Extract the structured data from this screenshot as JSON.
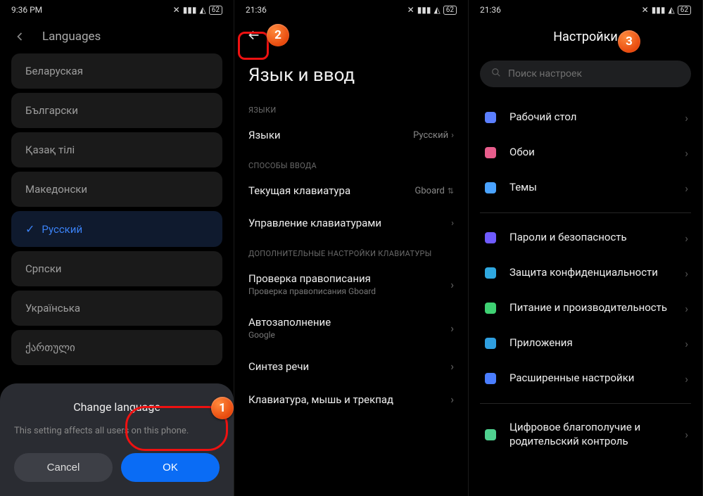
{
  "panel1": {
    "status_time": "9:36 PM",
    "status_battery": "62",
    "header_title": "Languages",
    "languages": [
      "Беларуская",
      "Български",
      "Қазақ тілі",
      "Македонски",
      "Русский",
      "Српски",
      "Українська",
      "ქართული"
    ],
    "selected_index": 4,
    "dialog": {
      "title": "Change language",
      "message": "This setting affects all users on this phone.",
      "cancel": "Cancel",
      "ok": "OK"
    }
  },
  "panel2": {
    "status_time": "21:36",
    "status_battery": "62",
    "title": "Язык и ввод",
    "section1": "ЯЗЫКИ",
    "row_languages": {
      "label": "Языки",
      "value": "Русский"
    },
    "section2": "СПОСОБЫ ВВОДА",
    "row_keyboard": {
      "label": "Текущая клавиатура",
      "value": "Gboard"
    },
    "row_manage": {
      "label": "Управление клавиатурами"
    },
    "section3": "ДОПОЛНИТЕЛЬНЫЕ НАСТРОЙКИ КЛАВИАТУРЫ",
    "row_spell": {
      "label": "Проверка правописания",
      "sub": "Проверка правописания Gboard"
    },
    "row_autofill": {
      "label": "Автозаполнение",
      "sub": "Google"
    },
    "row_tts": {
      "label": "Синтез речи"
    },
    "row_mouse": {
      "label": "Клавиатура, мышь и трекпад"
    }
  },
  "panel3": {
    "status_time": "21:36",
    "status_battery": "62",
    "header_title": "Настройки",
    "search_placeholder": "Поиск настроек",
    "items_top": [
      {
        "label": "Рабочий стол",
        "color": "#5b7fff"
      },
      {
        "label": "Обои",
        "color": "#e85d8c"
      },
      {
        "label": "Темы",
        "color": "#4aa3ff"
      }
    ],
    "items_bottom": [
      {
        "label": "Пароли и безопасность",
        "color": "#6f5bff"
      },
      {
        "label": "Защита конфиденциальности",
        "color": "#2fa8e0"
      },
      {
        "label": "Питание и производительность",
        "color": "#3fd173"
      },
      {
        "label": "Приложения",
        "color": "#2f9fe0"
      },
      {
        "label": "Расширенные настройки",
        "color": "#4a7dff"
      }
    ],
    "items_last": [
      {
        "label": "Цифровое благополучие и родительский контроль",
        "color": "#4fd18f"
      }
    ]
  },
  "badges": {
    "b1": "1",
    "b2": "2",
    "b3": "3"
  }
}
